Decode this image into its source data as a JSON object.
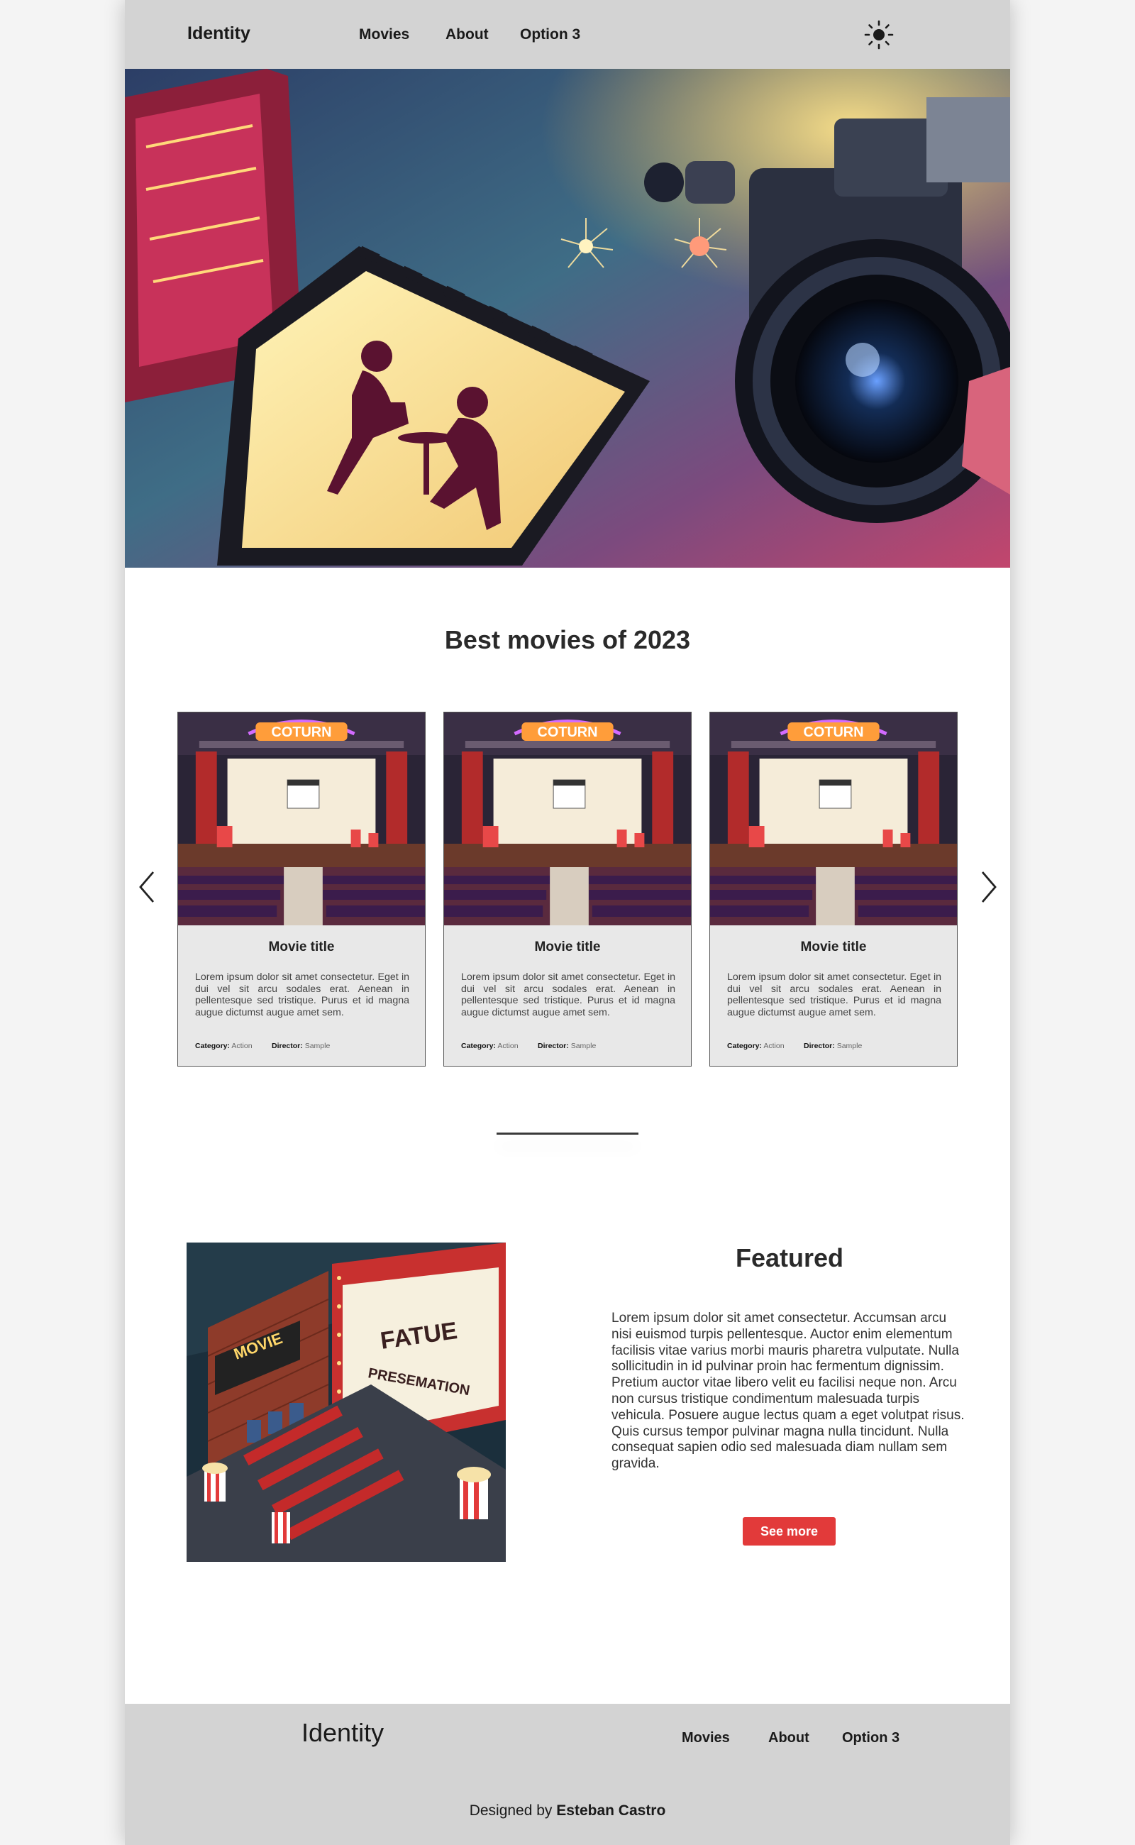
{
  "nav": {
    "brand": "Identity",
    "links": [
      "Movies",
      "About",
      "Option 3"
    ],
    "theme_icon": "sun-icon"
  },
  "hero": {
    "image": "cinema-collage-illustration"
  },
  "best": {
    "title": "Best movies of 2023",
    "cards": [
      {
        "title": "Movie title",
        "text": "Lorem ipsum dolor sit amet consectetur. Eget in dui vel sit arcu sodales erat. Aenean in pellentesque sed tristique. Purus et id magna augue dictumst augue amet sem.",
        "category_label": "Category:",
        "category": "Action",
        "director_label": "Director:",
        "director": "Sample",
        "marquee": "COTURN"
      },
      {
        "title": "Movie title",
        "text": "Lorem ipsum dolor sit amet consectetur. Eget in dui vel sit arcu sodales erat. Aenean in pellentesque sed tristique. Purus et id magna augue dictumst augue amet sem.",
        "category_label": "Category:",
        "category": "Action",
        "director_label": "Director:",
        "director": "Sample",
        "marquee": "COTURN"
      },
      {
        "title": "Movie title",
        "text": "Lorem ipsum dolor sit amet consectetur. Eget in dui vel sit arcu sodales erat. Aenean in pellentesque sed tristique. Purus et id magna augue dictumst augue amet sem.",
        "category_label": "Category:",
        "category": "Action",
        "director_label": "Director:",
        "director": "Sample",
        "marquee": "COTURN"
      }
    ],
    "prev_icon": "chevron-left-icon",
    "next_icon": "chevron-right-icon"
  },
  "featured": {
    "title": "Featured",
    "text": "Lorem ipsum dolor sit amet consectetur. Accumsan arcu nisi euismod turpis pellentesque. Auctor enim elementum facilisis vitae varius morbi mauris pharetra vulputate. Nulla sollicitudin in id pulvinar proin hac fermentum dignissim. Pretium auctor vitae libero velit eu facilisi neque non. Arcu non cursus tristique condimentum malesuada turpis vehicula. Posuere augue lectus quam a eget volutpat risus. Quis cursus tempor pulvinar magna nulla tincidunt. Nulla consequat sapien odio sed malesuada diam nullam sem gravida.",
    "button": "See more",
    "image_signs": {
      "movie": "MOVIE",
      "board": "FATUE",
      "board2": "PRESEMATION"
    }
  },
  "footer": {
    "brand": "Identity",
    "links": [
      "Movies",
      "About",
      "Option 3"
    ],
    "credit_prefix": "Designed by ",
    "credit_name": "Esteban Castro"
  },
  "colors": {
    "nav_bg": "#d3d3d3",
    "accent": "#e23a3a",
    "card_bg": "#e8e8e8"
  }
}
